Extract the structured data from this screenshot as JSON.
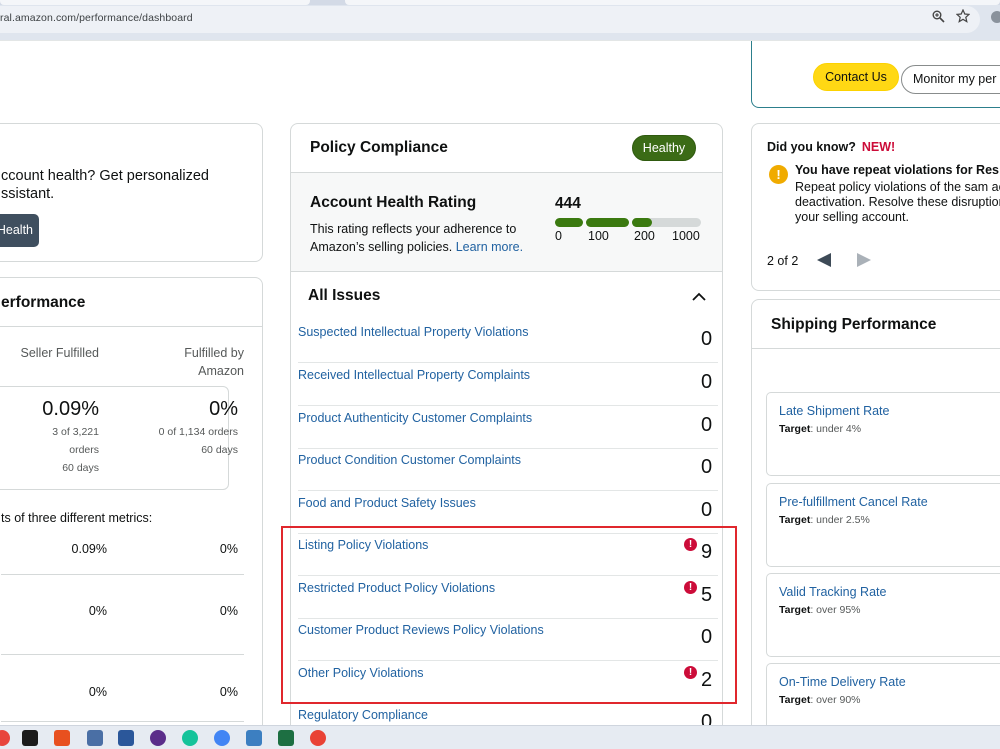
{
  "browser": {
    "url": "ral.amazon.com/performance/dashboard",
    "zoom_icon": "zoom-icon",
    "bookmark_icon": "star-icon",
    "profile_icon": "profile-icon"
  },
  "top_right": {
    "contact_us": "Contact Us",
    "monitor": "Monitor my per"
  },
  "assistant_card": {
    "text_line1": "ccount health? Get personalized",
    "text_line2": "ssistant.",
    "button": "Health"
  },
  "seller_performance": {
    "title": "erformance",
    "col_seller": "Seller Fulfilled",
    "col_amazon_line1": "Fulfilled by",
    "col_amazon_line2": "Amazon",
    "seller_pct": "0.09%",
    "seller_detail_line1": "3 of 3,221",
    "seller_detail_line2": "orders",
    "seller_days": "60 days",
    "amazon_pct": "0%",
    "amazon_detail": "0 of 1,134 orders",
    "amazon_days": "60 days",
    "metrics_note": "ts of three different metrics:",
    "rows": [
      {
        "seller": "0.09%",
        "amazon": "0%"
      },
      {
        "seller": "0%",
        "amazon": "0%"
      },
      {
        "seller": "0%",
        "amazon": "0%"
      }
    ]
  },
  "policy_compliance": {
    "title": "Policy Compliance",
    "status": "Healthy",
    "ahr_title": "Account Health Rating",
    "ahr_desc": "This rating reflects your adherence to Amazon’s selling policies.",
    "ahr_learn_more": "Learn more.",
    "ahr_score": "444",
    "ahr_scale": [
      "0",
      "100",
      "200",
      "1000"
    ],
    "all_issues": "All Issues",
    "issues": [
      {
        "label": "Suspected Intellectual Property Violations",
        "count": "0",
        "alert": false
      },
      {
        "label": "Received Intellectual Property Complaints",
        "count": "0",
        "alert": false
      },
      {
        "label": "Product Authenticity Customer Complaints",
        "count": "0",
        "alert": false
      },
      {
        "label": "Product Condition Customer Complaints",
        "count": "0",
        "alert": false
      },
      {
        "label": "Food and Product Safety Issues",
        "count": "0",
        "alert": false
      },
      {
        "label": "Listing Policy Violations",
        "count": "9",
        "alert": true
      },
      {
        "label": "Restricted Product Policy Violations",
        "count": "5",
        "alert": true
      },
      {
        "label": "Customer Product Reviews Policy Violations",
        "count": "0",
        "alert": false
      },
      {
        "label": "Other Policy Violations",
        "count": "2",
        "alert": true
      },
      {
        "label": "Regulatory Compliance",
        "count": "0",
        "alert": false
      }
    ]
  },
  "did_you_know": {
    "title": "Did you know?",
    "new": "NEW!",
    "headline": "You have repeat violations for Res",
    "body": "Repeat policy violations of the sam account deactivation. Resolve these disruption to your selling account.",
    "pager": "2 of 2"
  },
  "shipping_performance": {
    "title": "Shipping Performance",
    "rates": [
      {
        "name": "Late Shipment Rate",
        "target_label": "Target",
        "target": ": under 4%"
      },
      {
        "name": "Pre-fulfillment Cancel Rate",
        "target_label": "Target",
        "target": ": under 2.5%"
      },
      {
        "name": "Valid Tracking Rate",
        "target_label": "Target",
        "target": ": over 95%"
      },
      {
        "name": "On-Time Delivery Rate",
        "target_label": "Target",
        "target": ": over 90%"
      }
    ]
  },
  "colors": {
    "accent_yellow": "#ffd814",
    "healthy_green": "#3b6b16",
    "link_blue": "#2162a1",
    "alert_red": "#cc0c39",
    "highlight_red": "#e0272d"
  }
}
